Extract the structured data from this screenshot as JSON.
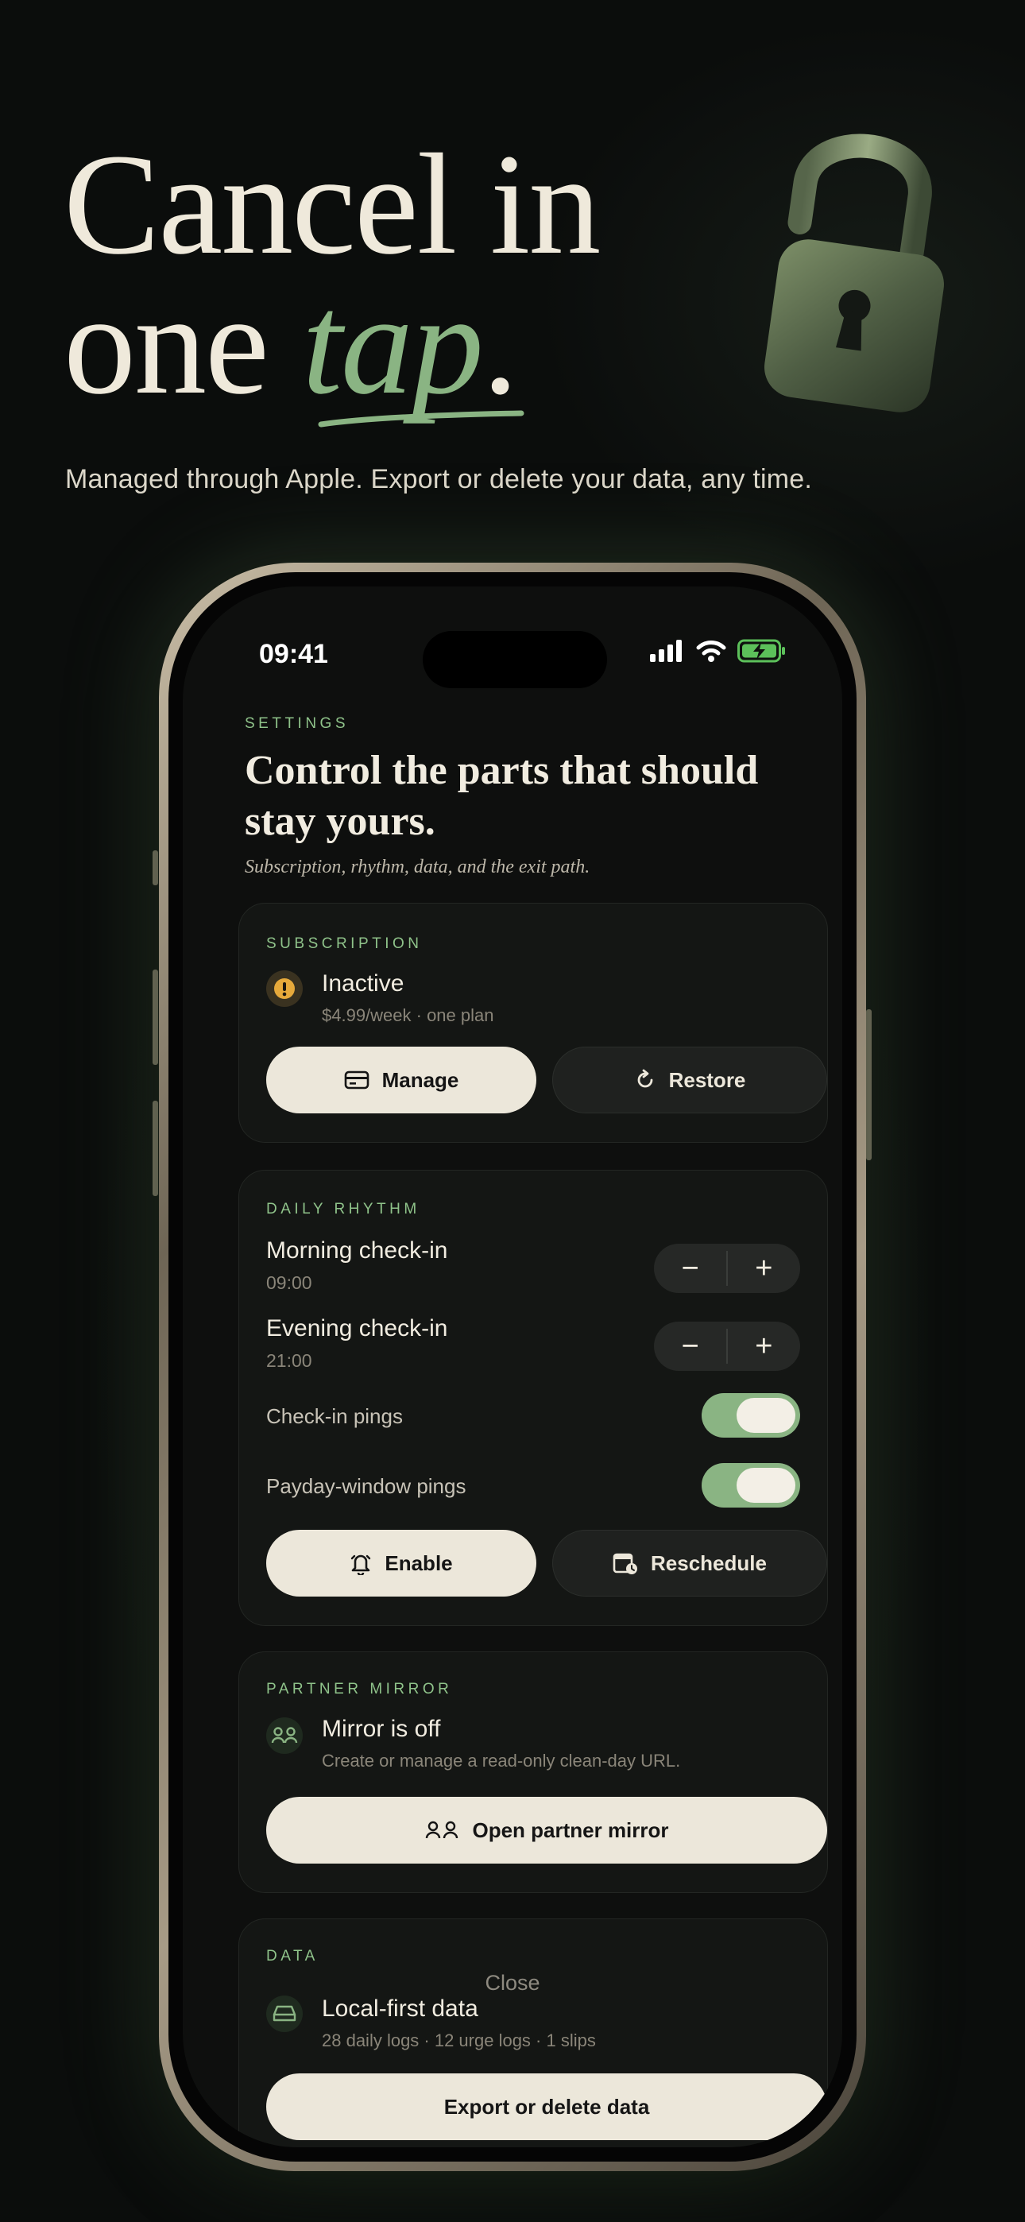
{
  "hero": {
    "title_line1": "Cancel in",
    "title_line2_prefix": "one ",
    "title_accent": "tap",
    "title_suffix": ".",
    "subtitle": "Managed through Apple. Export or delete your data, any time."
  },
  "status_bar": {
    "time": "09:41"
  },
  "settings": {
    "eyebrow": "SETTINGS",
    "title": "Control the parts that should stay yours.",
    "subtitle": "Subscription, rhythm, data, and the exit path."
  },
  "subscription": {
    "eyebrow": "SUBSCRIPTION",
    "status": "Inactive",
    "plan": "$4.99/week · one plan",
    "manage_label": "Manage",
    "restore_label": "Restore"
  },
  "daily_rhythm": {
    "eyebrow": "DAILY RHYTHM",
    "morning_label": "Morning check-in",
    "morning_time": "09:00",
    "evening_label": "Evening check-in",
    "evening_time": "21:00",
    "minus": "−",
    "plus": "+",
    "checkin_pings_label": "Check-in pings",
    "checkin_pings_on": true,
    "payday_pings_label": "Payday-window pings",
    "payday_pings_on": true,
    "enable_label": "Enable",
    "reschedule_label": "Reschedule"
  },
  "partner_mirror": {
    "eyebrow": "PARTNER MIRROR",
    "status": "Mirror is off",
    "description": "Create or manage a read-only clean-day URL.",
    "open_label": "Open partner mirror"
  },
  "data_section": {
    "eyebrow": "DATA",
    "close_label": "Close",
    "title": "Local-first data",
    "stats": "28 daily logs · 12 urge logs · 1 slips",
    "export_label": "Export or delete data"
  },
  "colors": {
    "accent_green": "#8ab483",
    "eyebrow_green": "#8fc38a",
    "cream": "#ece7da",
    "warning_amber": "#e6a93b",
    "background": "#0b0d0c"
  },
  "icons": [
    "lock-open-icon",
    "signal-icon",
    "wifi-icon",
    "battery-charging-icon",
    "warning-icon",
    "credit-card-icon",
    "restore-icon",
    "bell-icon",
    "calendar-clock-icon",
    "partner-icon",
    "drive-icon"
  ]
}
